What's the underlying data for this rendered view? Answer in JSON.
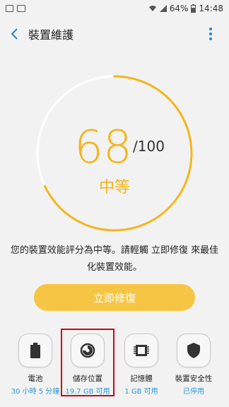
{
  "status_bar": {
    "battery": "64%",
    "time": "14:48"
  },
  "header": {
    "title": "裝置維護"
  },
  "gauge": {
    "score": "68",
    "max": "/100",
    "grade": "中等",
    "level": 0.68,
    "accent_color": "#f4b51c",
    "track_color": "#ffffff"
  },
  "description": "您的裝置效能評分為中等。請輕觸 立即修復 來最佳化裝置效能。",
  "fix_button_label": "立即修復",
  "items": [
    {
      "label": "電池",
      "sub": "30 小時 5 分鐘",
      "icon": "battery-icon"
    },
    {
      "label": "儲存位置",
      "sub": "19.7 GB 可用",
      "icon": "storage-icon"
    },
    {
      "label": "記憶體",
      "sub": "1 GB 可用",
      "icon": "memory-chip-icon"
    },
    {
      "label": "裝置安全性",
      "sub": "已停用",
      "icon": "shield-icon"
    }
  ]
}
